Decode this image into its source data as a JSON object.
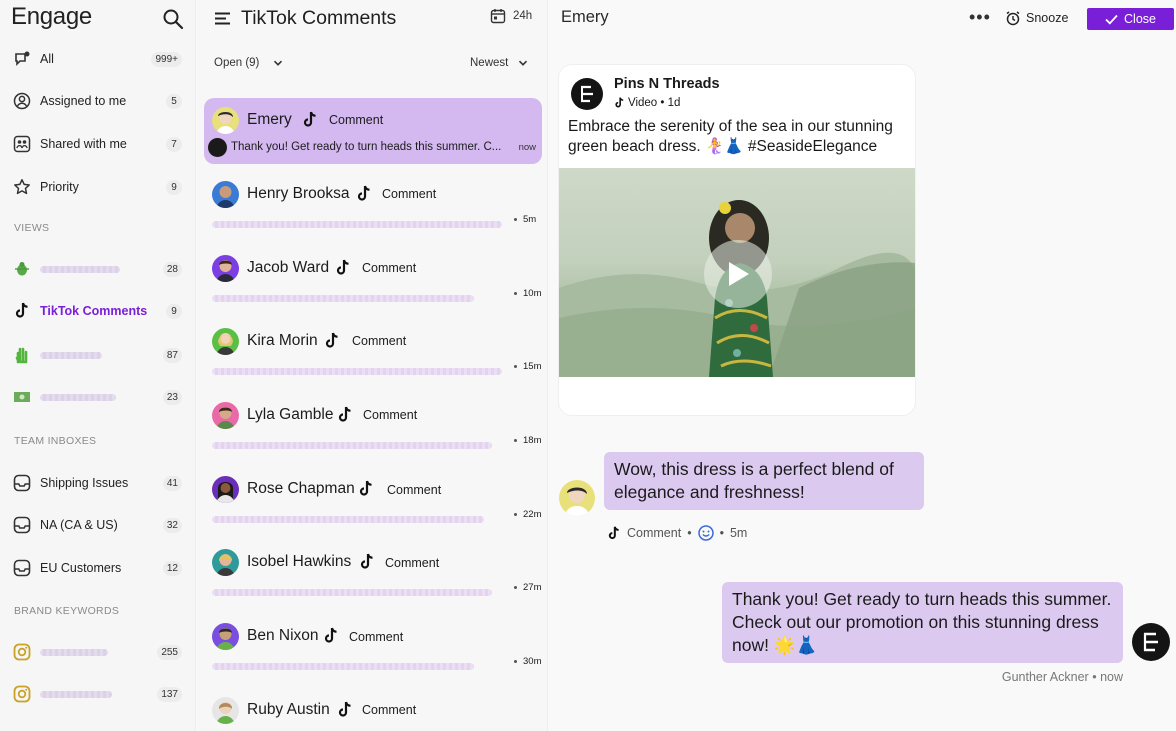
{
  "sidebar": {
    "brand": "Engage",
    "items": [
      {
        "label": "All",
        "count": "999+"
      },
      {
        "label": "Assigned to me",
        "count": "5"
      },
      {
        "label": "Shared with me",
        "count": "7"
      },
      {
        "label": "Priority",
        "count": "9"
      }
    ],
    "views_title": "VIEWS",
    "views": [
      {
        "label": "",
        "count": "28"
      },
      {
        "label": "TikTok Comments",
        "count": "9"
      },
      {
        "label": "",
        "count": "87"
      },
      {
        "label": "",
        "count": "23"
      }
    ],
    "team_title": "TEAM INBOXES",
    "team": [
      {
        "label": "Shipping Issues",
        "count": "41"
      },
      {
        "label": "NA (CA & US)",
        "count": "32"
      },
      {
        "label": "EU Customers",
        "count": "12"
      }
    ],
    "keywords_title": "BRAND KEYWORDS",
    "keywords": [
      {
        "label": "",
        "count": "255"
      },
      {
        "label": "",
        "count": "137"
      }
    ]
  },
  "list": {
    "title": "TikTok Comments",
    "period": "24h",
    "filter_status": "Open (9)",
    "sort": "Newest",
    "conversations": [
      {
        "name": "Emery",
        "type": "Comment",
        "snippet": "Thank you! Get ready to turn heads this summer. C...",
        "time": "now"
      },
      {
        "name": "Henry Brooksa",
        "type": "Comment",
        "time": "5m"
      },
      {
        "name": "Jacob Ward",
        "type": "Comment",
        "time": "10m"
      },
      {
        "name": "Kira Morin",
        "type": "Comment",
        "time": "15m"
      },
      {
        "name": "Lyla Gamble",
        "type": "Comment",
        "time": "18m"
      },
      {
        "name": "Rose Chapman",
        "type": "Comment",
        "time": "22m"
      },
      {
        "name": "Isobel Hawkins",
        "type": "Comment",
        "time": "27m"
      },
      {
        "name": "Ben Nixon",
        "type": "Comment",
        "time": "30m"
      },
      {
        "name": "Ruby Austin",
        "type": "Comment",
        "time": ""
      }
    ]
  },
  "detail": {
    "name": "Emery",
    "more": "•••",
    "snooze": "Snooze",
    "close": "Close",
    "post": {
      "author": "Pins N Threads",
      "meta": "Video • 1d",
      "text": "Embrace the serenity of the sea in our stunning green beach dress. 🧜‍♀️👗 #SeasideElegance"
    },
    "incoming": {
      "text": "Wow, this dress is a perfect blend of elegance and freshness!",
      "type": "Comment",
      "time": "5m"
    },
    "outgoing": {
      "text": "Thank you! Get ready to turn heads this summer. Check out our promotion on this stunning dress now! 🌟👗",
      "agent": "Gunther Ackner",
      "time": "now"
    }
  },
  "colors": {
    "accent": "#7a1fd8",
    "selected": "#d4b8f0",
    "bubble": "#dcc9ef"
  }
}
